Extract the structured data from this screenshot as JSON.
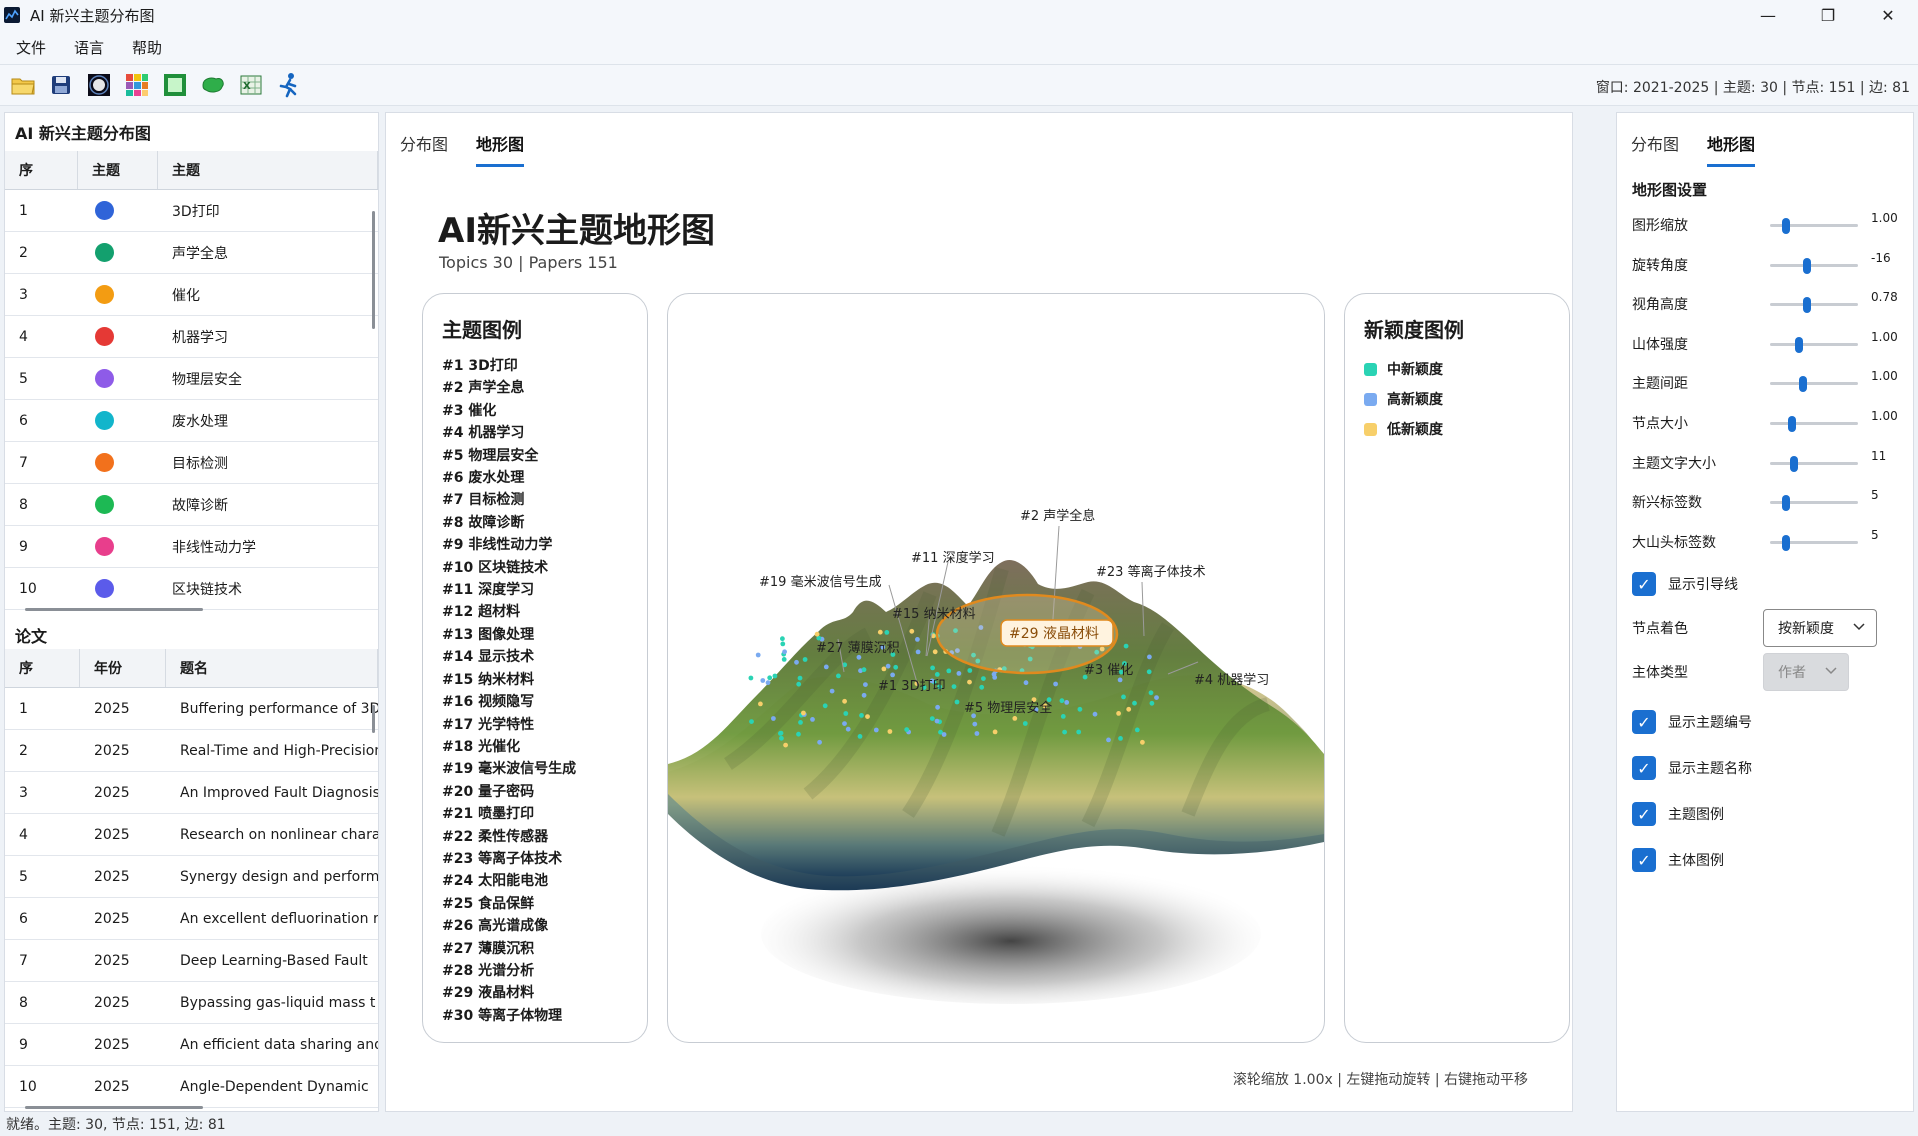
{
  "window": {
    "title": "AI 新兴主题分布图",
    "minimize": "—",
    "maximize": "❐",
    "close": "✕"
  },
  "menu": {
    "file": "文件",
    "language": "语言",
    "help": "帮助"
  },
  "toolbar": {
    "icons": [
      "folder-open-icon",
      "save-icon",
      "glow-export-icon",
      "color-palette-icon",
      "frame-export-icon",
      "blob-shape-icon",
      "excel-export-icon",
      "runner-icon"
    ],
    "stats": "窗口: 2021-2025 | 主题: 30 | 节点: 151 | 边: 81"
  },
  "left": {
    "title": "AI 新兴主题分布图",
    "topic_headers": [
      "序",
      "主题",
      "主题"
    ],
    "topics": [
      {
        "no": "1",
        "color": "#2f64d8",
        "name": "3D打印"
      },
      {
        "no": "2",
        "color": "#13a06e",
        "name": "声学全息"
      },
      {
        "no": "3",
        "color": "#f39c12",
        "name": "催化"
      },
      {
        "no": "4",
        "color": "#e53935",
        "name": "机器学习"
      },
      {
        "no": "5",
        "color": "#8e5be8",
        "name": "物理层安全"
      },
      {
        "no": "6",
        "color": "#12b5cb",
        "name": "废水处理"
      },
      {
        "no": "7",
        "color": "#f2711c",
        "name": "目标检测"
      },
      {
        "no": "8",
        "color": "#1db954",
        "name": "故障诊断"
      },
      {
        "no": "9",
        "color": "#e83e8c",
        "name": "非线性动力学"
      },
      {
        "no": "10",
        "color": "#5b5bea",
        "name": "区块链技术"
      }
    ],
    "papers_title": "论文",
    "paper_headers": [
      "序",
      "年份",
      "题名"
    ],
    "papers": [
      {
        "no": "1",
        "year": "2025",
        "title": "Buffering performance of 3D"
      },
      {
        "no": "2",
        "year": "2025",
        "title": "Real-Time and High-Precision"
      },
      {
        "no": "3",
        "year": "2025",
        "title": "An Improved Fault Diagnosis"
      },
      {
        "no": "4",
        "year": "2025",
        "title": "Research on nonlinear chara"
      },
      {
        "no": "5",
        "year": "2025",
        "title": "Synergy design and perform"
      },
      {
        "no": "6",
        "year": "2025",
        "title": "An excellent defluorination r"
      },
      {
        "no": "7",
        "year": "2025",
        "title": "Deep Learning-Based Fault"
      },
      {
        "no": "8",
        "year": "2025",
        "title": "Bypassing gas-liquid mass t"
      },
      {
        "no": "9",
        "year": "2025",
        "title": "An efficient data sharing and"
      },
      {
        "no": "10",
        "year": "2025",
        "title": "Angle-Dependent Dynamic"
      }
    ]
  },
  "center": {
    "tabs": [
      "分布图",
      "地形图"
    ],
    "title": "AI新兴主题地形图",
    "subtitle": "Topics 30 | Papers 151",
    "legend_title": "主题图例",
    "legend": [
      "#1 3D打印",
      "#2 声学全息",
      "#3 催化",
      "#4 机器学习",
      "#5 物理层安全",
      "#6 废水处理",
      "#7 目标检测",
      "#8 故障诊断",
      "#9 非线性动力学",
      "#10 区块链技术",
      "#11 深度学习",
      "#12 超材料",
      "#13 图像处理",
      "#14 显示技术",
      "#15 纳米材料",
      "#16 视频隐写",
      "#17 光学特性",
      "#18 光催化",
      "#19 毫米波信号生成",
      "#20 量子密码",
      "#21 喷墨打印",
      "#22 柔性传感器",
      "#23 等离子体技术",
      "#24 太阳能电池",
      "#25 食品保鲜",
      "#26 高光谱成像",
      "#27 薄膜沉积",
      "#28 光谱分析",
      "#29 液晶材料",
      "#30 等离子体物理"
    ],
    "novelty_title": "新颖度图例",
    "novelty": [
      {
        "label": "中新颖度",
        "color": "#2ad3b4"
      },
      {
        "label": "高新颖度",
        "color": "#7aaaf0"
      },
      {
        "label": "低新颖度",
        "color": "#f7cf6a"
      }
    ],
    "map_labels": [
      {
        "text": "#2 声学全息"
      },
      {
        "text": "#11 深度学习"
      },
      {
        "text": "#23 等离子体技术"
      },
      {
        "text": "#19 毫米波信号生成"
      },
      {
        "text": "#15 纳米材料"
      },
      {
        "text": "#27 薄膜沉积"
      },
      {
        "text": "#1 3D打印"
      },
      {
        "text": "#5 物理层安全"
      },
      {
        "text": "#3 催化"
      },
      {
        "text": "#4 机器学习"
      }
    ],
    "highlight_label": "#29 液晶材料",
    "hint": "滚轮缩放 1.00x | 左键拖动旋转 | 右键拖动平移"
  },
  "right": {
    "tabs": [
      "分布图",
      "地形图"
    ],
    "section_title": "地形图设置",
    "sliders": [
      {
        "label": "图形缩放",
        "value": "1.00",
        "level": 0.18
      },
      {
        "label": "旋转角度",
        "value": "-16",
        "level": 0.42
      },
      {
        "label": "视角高度",
        "value": "0.78",
        "level": 0.42
      },
      {
        "label": "山体强度",
        "value": "1.00",
        "level": 0.33
      },
      {
        "label": "主题间距",
        "value": "1.00",
        "level": 0.38
      },
      {
        "label": "节点大小",
        "value": "1.00",
        "level": 0.25
      },
      {
        "label": "主题文字大小",
        "value": "11",
        "level": 0.27
      },
      {
        "label": "新兴标签数",
        "value": "5",
        "level": 0.18
      },
      {
        "label": "大山头标签数",
        "value": "5",
        "level": 0.18
      }
    ],
    "show_leader": "显示引导线",
    "node_color_label": "节点着色",
    "node_color_value": "按新颖度",
    "entity_type_label": "主体类型",
    "entity_type_value": "作者",
    "checks": [
      "显示主题编号",
      "显示主题名称",
      "主题图例",
      "主体图例"
    ]
  },
  "status": "就绪。主题: 30, 节点: 151, 边: 81"
}
